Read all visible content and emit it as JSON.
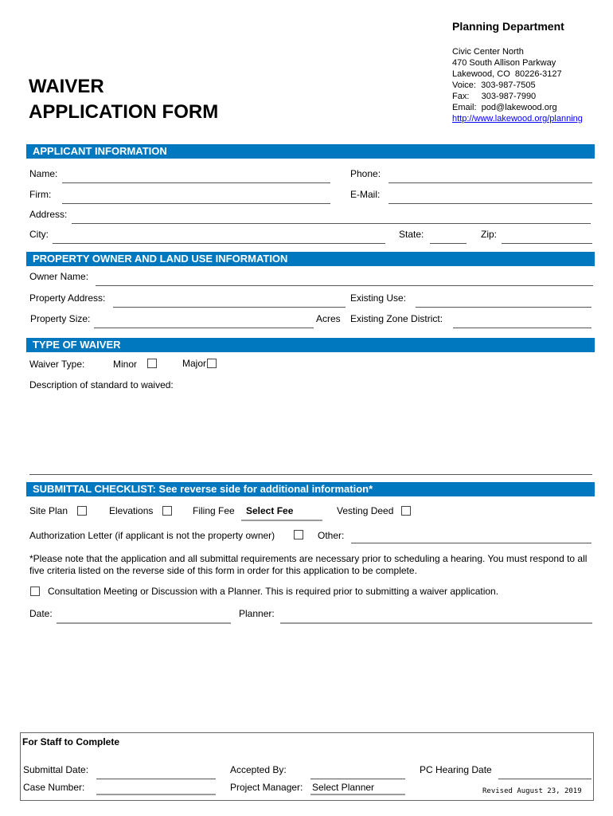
{
  "header": {
    "department": "Planning Department",
    "address_lines": [
      "Civic Center North",
      "470 South Allison Parkway",
      "Lakewood, CO  80226-3127",
      "Voice:  303-987-7505",
      "Fax:     303-987-7990",
      "Email:  pod@lakewood.org"
    ],
    "website": "http://www.lakewood.org/planning",
    "title_line1": "WAIVER",
    "title_line2": "APPLICATION FORM"
  },
  "applicant": {
    "section_title": "APPLICANT INFORMATION",
    "name_label": "Name:",
    "phone_label": "Phone:",
    "firm_label": "Firm:",
    "email_label": "E-Mail:",
    "address_label": "Address:",
    "city_label": "City:",
    "state_label": "State:",
    "zip_label": "Zip:"
  },
  "property": {
    "section_title": "PROPERTY OWNER AND LAND USE INFORMATION",
    "owner_label": "Owner Name:",
    "address_label": "Property Address:",
    "existing_use_label": "Existing Use:",
    "size_label": "Property Size:",
    "acres_label": "Acres",
    "zone_label": "Existing Zone District:"
  },
  "waiver": {
    "section_title": "TYPE OF WAIVER",
    "type_label": "Waiver Type:",
    "minor_label": "Minor",
    "major_label": "Major",
    "description_label": "Description of standard to waived:"
  },
  "checklist": {
    "section_title": "SUBMITTAL CHECKLIST: See reverse side for additional information*",
    "site_plan_label": "Site Plan",
    "elevations_label": "Elevations",
    "filing_fee_label": "Filing Fee",
    "filing_fee_value": "Select Fee",
    "vesting_deed_label": "Vesting Deed",
    "authorization_label": "Authorization Letter (if applicant is not the property owner)",
    "other_label": "Other:",
    "note": "*Please note that the application and all submittal requirements are necessary prior to scheduling a hearing.  You must respond to all five criteria listed on the reverse side of this form in order for this application to be complete.",
    "consultation_label": "Consultation Meeting or Discussion with a Planner.  This is required prior to submitting a waiver application.",
    "date_label": "Date:",
    "planner_label": "Planner:"
  },
  "staff": {
    "title": "For Staff to Complete",
    "submittal_date_label": "Submittal Date:",
    "accepted_by_label": "Accepted By:",
    "pc_hearing_label": "PC Hearing Date",
    "case_number_label": "Case Number:",
    "project_manager_label": "Project Manager:",
    "project_manager_value": "Select Planner",
    "revised": "Revised August 23, 2019"
  }
}
